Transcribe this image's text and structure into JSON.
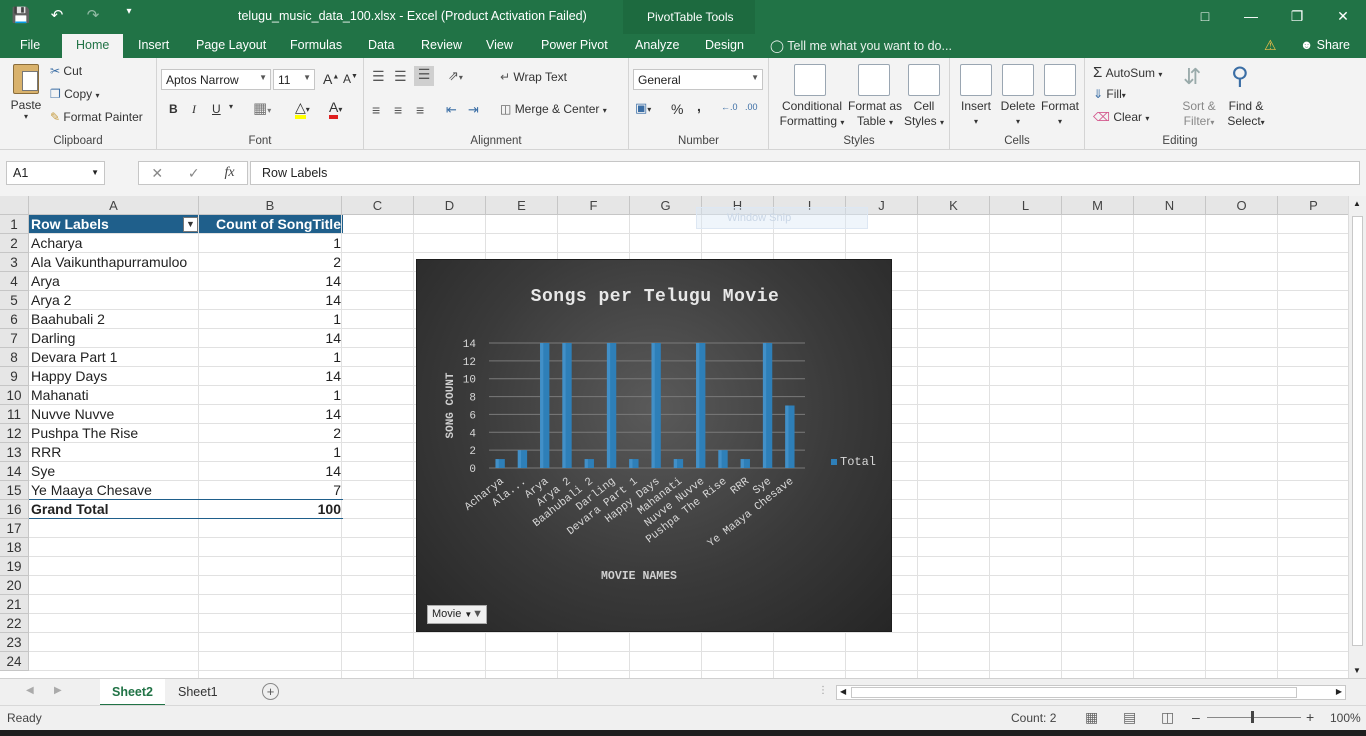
{
  "app": {
    "doc_title": "telugu_music_data_100.xlsx - Excel (Product Activation Failed)",
    "context_tab_group": "PivotTable Tools"
  },
  "ribbon_tabs": [
    "File",
    "Home",
    "Insert",
    "Page Layout",
    "Formulas",
    "Data",
    "Review",
    "View",
    "Power Pivot",
    "Analyze",
    "Design"
  ],
  "tell_me": "Tell me what you want to do...",
  "share_label": "Share",
  "ribbon": {
    "clipboard": {
      "paste": "Paste",
      "cut": "Cut",
      "copy": "Copy",
      "format_painter": "Format Painter",
      "label": "Clipboard"
    },
    "font": {
      "name": "Aptos Narrow",
      "size": "11",
      "bold": "B",
      "italic": "I",
      "underline": "U",
      "label": "Font"
    },
    "alignment": {
      "wrap_text": "Wrap Text",
      "merge_center": "Merge & Center",
      "label": "Alignment"
    },
    "number": {
      "format": "General",
      "percent": "%",
      "comma": ",",
      "label": "Number"
    },
    "styles": {
      "conditional": "Conditional",
      "conditional2": "Formatting",
      "format_as": "Format as",
      "format_as2": "Table",
      "cell": "Cell",
      "cell2": "Styles",
      "label": "Styles"
    },
    "cells": {
      "insert": "Insert",
      "delete": "Delete",
      "format": "Format",
      "label": "Cells"
    },
    "editing": {
      "autosum": "AutoSum",
      "fill": "Fill",
      "clear": "Clear",
      "sort": "Sort &",
      "sort2": "Filter",
      "find": "Find &",
      "find2": "Select",
      "label": "Editing"
    }
  },
  "formula_bar": {
    "name_box": "A1",
    "content": "Row Labels"
  },
  "columns": [
    "A",
    "B",
    "C",
    "D",
    "E",
    "F",
    "G",
    "H",
    "I",
    "J",
    "K",
    "L",
    "M",
    "N",
    "O",
    "P"
  ],
  "rows": [
    "1",
    "2",
    "3",
    "4",
    "5",
    "6",
    "7",
    "8",
    "9",
    "10",
    "11",
    "12",
    "13",
    "14",
    "15",
    "16",
    "17",
    "18",
    "19",
    "20",
    "21",
    "22",
    "23",
    "24"
  ],
  "pivot": {
    "header_a": "Row Labels",
    "header_b": "Count of SongTitle",
    "items": [
      {
        "label": "Acharya",
        "value": "1"
      },
      {
        "label": "Ala Vaikunthapurramuloo",
        "value": "2"
      },
      {
        "label": "Arya",
        "value": "14"
      },
      {
        "label": "Arya 2",
        "value": "14"
      },
      {
        "label": "Baahubali 2",
        "value": "1"
      },
      {
        "label": "Darling",
        "value": "14"
      },
      {
        "label": "Devara Part 1",
        "value": "1"
      },
      {
        "label": "Happy Days",
        "value": "14"
      },
      {
        "label": "Mahanati",
        "value": "1"
      },
      {
        "label": "Nuvve Nuvve",
        "value": "14"
      },
      {
        "label": "Pushpa The Rise",
        "value": "2"
      },
      {
        "label": "RRR",
        "value": "1"
      },
      {
        "label": "Sye",
        "value": "14"
      },
      {
        "label": "Ye Maaya Chesave",
        "value": "7"
      }
    ],
    "grand_total_label": "Grand Total",
    "grand_total_value": "100"
  },
  "watermark_text": "Window Snip",
  "chart_data": {
    "type": "bar",
    "title": "Songs per Telugu Movie",
    "xlabel": "MOVIE NAMES",
    "ylabel": "SONG COUNT",
    "categories": [
      "Acharya",
      "Ala...",
      "Arya",
      "Arya 2",
      "Baahubali 2",
      "Darling",
      "Devara Part 1",
      "Happy Days",
      "Mahanati",
      "Nuvve Nuvve",
      "Pushpa The Rise",
      "RRR",
      "Sye",
      "Ye Maaya Chesave"
    ],
    "series": [
      {
        "name": "Total",
        "values": [
          1,
          2,
          14,
          14,
          1,
          14,
          1,
          14,
          1,
          14,
          2,
          1,
          14,
          7
        ]
      }
    ],
    "yticks": [
      "0",
      "2",
      "4",
      "6",
      "8",
      "10",
      "12",
      "14"
    ],
    "ylim": [
      0,
      14
    ],
    "grid": true,
    "legend": "right",
    "bar_color": "#2e7fb8",
    "filter_button": "Movie"
  },
  "sheets": {
    "active": "Sheet2",
    "other": "Sheet1"
  },
  "status": {
    "ready": "Ready",
    "count": "Count: 2",
    "zoom": "100%"
  }
}
